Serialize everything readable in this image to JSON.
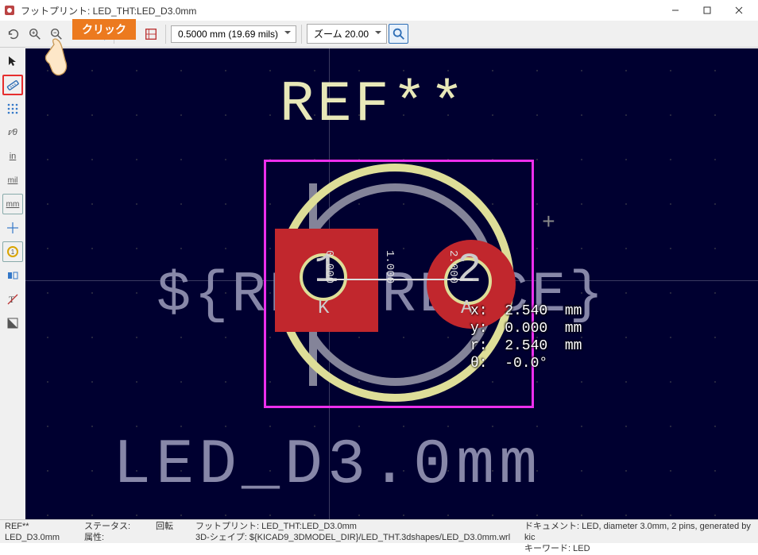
{
  "window": {
    "title": "フットプリント: LED_THT:LED_D3.0mm"
  },
  "toolbar": {
    "size_value": "0.5000 mm (19.69 mils)",
    "zoom_value": "ズーム 20.00"
  },
  "callout_label": "クリック",
  "canvas": {
    "ref_text": "REF**",
    "variable_text": "${REFERENCE}",
    "footprint_text": "LED_D3.0mm",
    "pad1_num": "1",
    "pad1_letter": "K",
    "pad2_num": "2",
    "pad2_letter": "A",
    "ruler_ticks": [
      "0.000",
      "1.000",
      "2.000"
    ],
    "measure": {
      "x": "x:  2.540  mm",
      "y": "y:  0.000  mm",
      "r": "r:  2.540  mm",
      "theta": "θ:  -0.0°"
    }
  },
  "status": {
    "ref": "REF**",
    "name": "LED_D3.0mm",
    "status_label": "ステータス:",
    "attr_label": "属性:",
    "rot_label": "回転",
    "fp_label": "フットプリント: LED_THT:LED_D3.0mm",
    "shape_label": "3D-シェイプ: ${KICAD9_3DMODEL_DIR}/LED_THT.3dshapes/LED_D3.0mm.wrl",
    "doc_label": "ドキュメント: LED, diameter 3.0mm, 2 pins, generated by kic",
    "kw_label": "キーワード: LED"
  }
}
